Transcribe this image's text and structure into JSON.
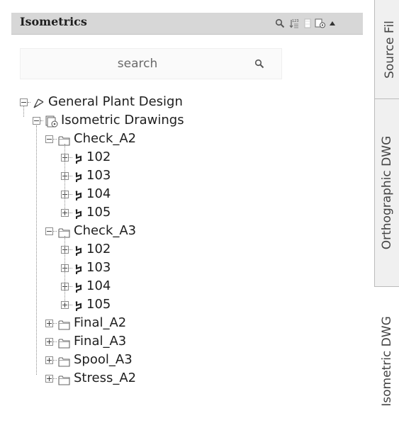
{
  "panel": {
    "title": "Isometrics"
  },
  "search": {
    "placeholder": "search"
  },
  "tree": {
    "root": "General Plant Design",
    "section": "Isometric Drawings",
    "folders": [
      {
        "label": "Check_A2",
        "items": [
          "102",
          "103",
          "104",
          "105"
        ]
      },
      {
        "label": "Check_A3",
        "items": [
          "102",
          "103",
          "104",
          "105"
        ]
      },
      {
        "label": "Final_A2",
        "items": []
      },
      {
        "label": "Final_A3",
        "items": []
      },
      {
        "label": "Spool_A3",
        "items": []
      },
      {
        "label": "Stress_A2",
        "items": []
      }
    ]
  },
  "side_tabs": {
    "source": "Source Fil",
    "orthographic": "Orthographic DWG",
    "isometric": "Isometric DWG"
  },
  "colors": {
    "header_bg": "#d7d7d7",
    "tab_bg": "#f0f0f0",
    "text": "#1e1e1e"
  },
  "icons": {
    "header": [
      "search-icon",
      "sort-icon",
      "list-icon",
      "settings-icon",
      "collapse-arrow-icon"
    ],
    "tree": [
      "project-icon",
      "drawings-icon",
      "folder-icon",
      "isometric-line-icon"
    ]
  }
}
